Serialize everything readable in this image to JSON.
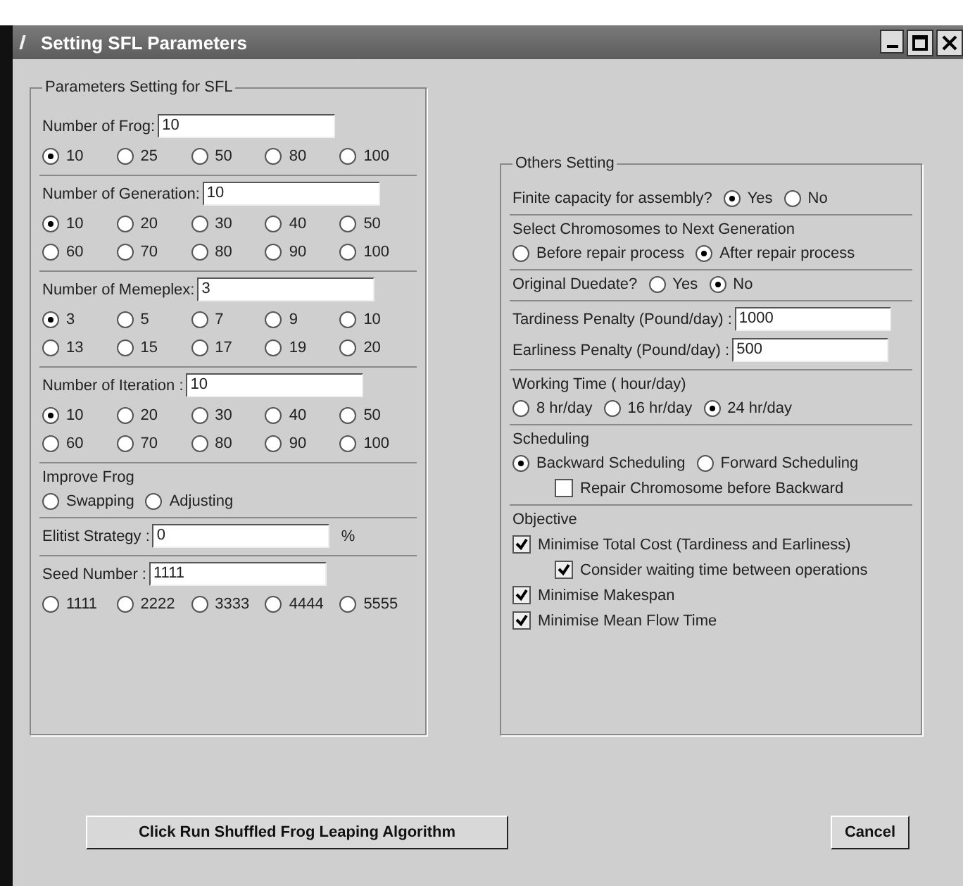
{
  "window": {
    "title": "Setting SFL Parameters"
  },
  "left_panel": {
    "title": "Parameters Setting for SFL",
    "sections": [
      {
        "rows": [
          {
            "kind": "field",
            "label": "Number of  Frog:",
            "value": "10"
          },
          {
            "kind": "radios",
            "options": [
              {
                "label": "10",
                "selected": true
              },
              {
                "label": "25",
                "selected": false
              },
              {
                "label": "50",
                "selected": false
              },
              {
                "label": "80",
                "selected": false
              },
              {
                "label": "100",
                "selected": false
              }
            ]
          }
        ]
      },
      {
        "rows": [
          {
            "kind": "field",
            "label": "Number of Generation:",
            "value": "10"
          },
          {
            "kind": "radios",
            "options": [
              {
                "label": "10",
                "selected": true
              },
              {
                "label": "20",
                "selected": false
              },
              {
                "label": "30",
                "selected": false
              },
              {
                "label": "40",
                "selected": false
              },
              {
                "label": "50",
                "selected": false
              },
              {
                "label": "60",
                "selected": false
              },
              {
                "label": "70",
                "selected": false
              },
              {
                "label": "80",
                "selected": false
              },
              {
                "label": "90",
                "selected": false
              },
              {
                "label": "100",
                "selected": false
              }
            ]
          }
        ]
      },
      {
        "rows": [
          {
            "kind": "field",
            "label": "Number of Memeplex:",
            "value": "3"
          },
          {
            "kind": "radios",
            "options": [
              {
                "label": "3",
                "selected": true
              },
              {
                "label": "5",
                "selected": false
              },
              {
                "label": "7",
                "selected": false
              },
              {
                "label": "9",
                "selected": false
              },
              {
                "label": "10",
                "selected": false
              },
              {
                "label": "13",
                "selected": false
              },
              {
                "label": "15",
                "selected": false
              },
              {
                "label": "17",
                "selected": false
              },
              {
                "label": "19",
                "selected": false
              },
              {
                "label": "20",
                "selected": false
              }
            ]
          }
        ]
      },
      {
        "rows": [
          {
            "kind": "field",
            "label": "Number of Iteration :",
            "value": "10"
          },
          {
            "kind": "radios",
            "options": [
              {
                "label": "10",
                "selected": true
              },
              {
                "label": "20",
                "selected": false
              },
              {
                "label": "30",
                "selected": false
              },
              {
                "label": "40",
                "selected": false
              },
              {
                "label": "50",
                "selected": false
              },
              {
                "label": "60",
                "selected": false
              },
              {
                "label": "70",
                "selected": false
              },
              {
                "label": "80",
                "selected": false
              },
              {
                "label": "90",
                "selected": false
              },
              {
                "label": "100",
                "selected": false
              }
            ]
          }
        ]
      },
      {
        "rows": [
          {
            "kind": "label",
            "text": "Improve Frog"
          },
          {
            "kind": "inline-radios",
            "options": [
              {
                "label": "Swapping",
                "selected": false
              },
              {
                "label": "Adjusting",
                "selected": false
              }
            ]
          }
        ]
      },
      {
        "rows": [
          {
            "kind": "field",
            "label": "Elitist Strategy :",
            "value": "0",
            "suffix": "%"
          }
        ]
      },
      {
        "rows": [
          {
            "kind": "field",
            "label": "Seed Number :",
            "value": "1111"
          },
          {
            "kind": "radios",
            "options": [
              {
                "label": "1111",
                "selected": false
              },
              {
                "label": "2222",
                "selected": false
              },
              {
                "label": "3333",
                "selected": false
              },
              {
                "label": "4444",
                "selected": false
              },
              {
                "label": "5555",
                "selected": false
              }
            ]
          }
        ]
      }
    ]
  },
  "right_panel": {
    "title": "Others Setting",
    "sections": [
      {
        "rows": [
          {
            "kind": "inline-radios",
            "label": "Finite capacity for assembly?",
            "options": [
              {
                "label": "Yes",
                "selected": true
              },
              {
                "label": "No",
                "selected": false
              }
            ]
          }
        ]
      },
      {
        "rows": [
          {
            "kind": "label",
            "text": "Select Chromosomes to Next Generation"
          },
          {
            "kind": "inline-radios",
            "options": [
              {
                "label": "Before repair process",
                "selected": false
              },
              {
                "label": "After repair process",
                "selected": true
              }
            ]
          }
        ]
      },
      {
        "rows": [
          {
            "kind": "inline-radios",
            "label": "Original Duedate?",
            "options": [
              {
                "label": "Yes",
                "selected": false
              },
              {
                "label": "No",
                "selected": true
              }
            ]
          }
        ]
      },
      {
        "rows": [
          {
            "kind": "field",
            "label": "Tardiness Penalty (Pound/day) :",
            "value": "1000"
          },
          {
            "kind": "field",
            "label": "Earliness Penalty (Pound/day) :",
            "value": "500"
          }
        ]
      },
      {
        "rows": [
          {
            "kind": "label",
            "text": "Working Time ( hour/day)"
          },
          {
            "kind": "inline-radios",
            "options": [
              {
                "label": "8  hr/day",
                "selected": false
              },
              {
                "label": "16 hr/day",
                "selected": false
              },
              {
                "label": "24 hr/day",
                "selected": true
              }
            ]
          }
        ]
      },
      {
        "rows": [
          {
            "kind": "label",
            "text": "Scheduling"
          },
          {
            "kind": "inline-radios",
            "options": [
              {
                "label": "Backward Scheduling",
                "selected": true
              },
              {
                "label": "Forward Scheduling",
                "selected": false
              }
            ]
          },
          {
            "kind": "checkbox",
            "label": "Repair Chromosome before Backward",
            "checked": false,
            "indent": true
          }
        ]
      },
      {
        "rows": [
          {
            "kind": "label",
            "text": "Objective"
          },
          {
            "kind": "checkbox",
            "label": "Minimise Total Cost (Tardiness and Earliness)",
            "checked": true,
            "children": [
              {
                "label": "Consider waiting time between operations",
                "checked": true
              }
            ]
          },
          {
            "kind": "checkbox",
            "label": "Minimise Makespan",
            "checked": true
          },
          {
            "kind": "checkbox",
            "label": "Minimise Mean Flow Time",
            "checked": true
          }
        ]
      }
    ]
  },
  "buttons": [
    {
      "kind": "run",
      "label": "Click  Run Shuffled Frog Leaping Algorithm"
    },
    {
      "kind": "cancel",
      "label": "Cancel"
    }
  ]
}
